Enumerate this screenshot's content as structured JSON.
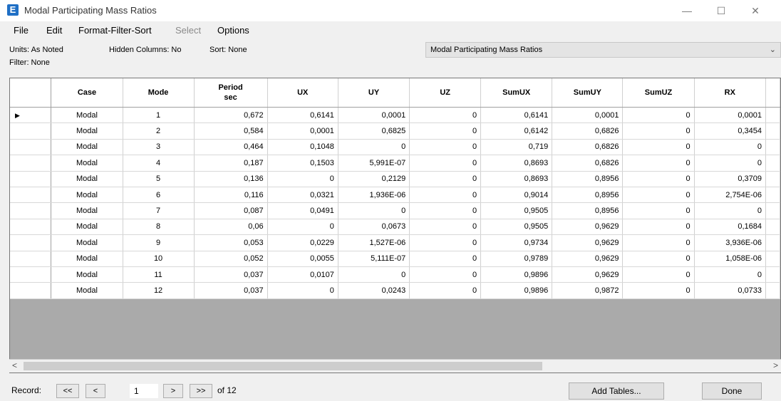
{
  "window": {
    "title": "Modal Participating Mass Ratios",
    "icon_letter": "E"
  },
  "window_controls": {
    "minimize": "—",
    "maximize": "☐",
    "close": "✕"
  },
  "menu": [
    "File",
    "Edit",
    "Format-Filter-Sort",
    "Select",
    "Options"
  ],
  "info": {
    "units": "Units: As Noted",
    "hidden_columns": "Hidden Columns: No",
    "sort": "Sort: None",
    "filter": "Filter: None"
  },
  "table_selector": {
    "value": "Modal Participating Mass Ratios",
    "icon": "chevron-down-icon"
  },
  "columns": [
    {
      "label": "Case",
      "unit": ""
    },
    {
      "label": "Mode",
      "unit": ""
    },
    {
      "label": "Period",
      "unit": "sec"
    },
    {
      "label": "UX",
      "unit": ""
    },
    {
      "label": "UY",
      "unit": ""
    },
    {
      "label": "UZ",
      "unit": ""
    },
    {
      "label": "SumUX",
      "unit": ""
    },
    {
      "label": "SumUY",
      "unit": ""
    },
    {
      "label": "SumUZ",
      "unit": ""
    },
    {
      "label": "RX",
      "unit": ""
    }
  ],
  "rows": [
    [
      "Modal",
      "1",
      "0,672",
      "0,6141",
      "0,0001",
      "0",
      "0,6141",
      "0,0001",
      "0",
      "0,0001"
    ],
    [
      "Modal",
      "2",
      "0,584",
      "0,0001",
      "0,6825",
      "0",
      "0,6142",
      "0,6826",
      "0",
      "0,3454"
    ],
    [
      "Modal",
      "3",
      "0,464",
      "0,1048",
      "0",
      "0",
      "0,719",
      "0,6826",
      "0",
      "0"
    ],
    [
      "Modal",
      "4",
      "0,187",
      "0,1503",
      "5,991E-07",
      "0",
      "0,8693",
      "0,6826",
      "0",
      "0"
    ],
    [
      "Modal",
      "5",
      "0,136",
      "0",
      "0,2129",
      "0",
      "0,8693",
      "0,8956",
      "0",
      "0,3709"
    ],
    [
      "Modal",
      "6",
      "0,116",
      "0,0321",
      "1,936E-06",
      "0",
      "0,9014",
      "0,8956",
      "0",
      "2,754E-06"
    ],
    [
      "Modal",
      "7",
      "0,087",
      "0,0491",
      "0",
      "0",
      "0,9505",
      "0,8956",
      "0",
      "0"
    ],
    [
      "Modal",
      "8",
      "0,06",
      "0",
      "0,0673",
      "0",
      "0,9505",
      "0,9629",
      "0",
      "0,1684"
    ],
    [
      "Modal",
      "9",
      "0,053",
      "0,0229",
      "1,527E-06",
      "0",
      "0,9734",
      "0,9629",
      "0",
      "3,936E-06"
    ],
    [
      "Modal",
      "10",
      "0,052",
      "0,0055",
      "5,111E-07",
      "0",
      "0,9789",
      "0,9629",
      "0",
      "1,058E-06"
    ],
    [
      "Modal",
      "11",
      "0,037",
      "0,0107",
      "0",
      "0",
      "0,9896",
      "0,9629",
      "0",
      "0"
    ],
    [
      "Modal",
      "12",
      "0,037",
      "0",
      "0,0243",
      "0",
      "0,9896",
      "0,9872",
      "0",
      "0,0733"
    ]
  ],
  "current_row_marker": "▶",
  "scrollbar": {
    "left_arrow": "<",
    "right_arrow": ">"
  },
  "footer": {
    "record_label": "Record:",
    "first": "<<",
    "prev": "<",
    "record_value": "1",
    "next": ">",
    "last": ">>",
    "of_label": "of 12",
    "add_tables": "Add Tables...",
    "done": "Done"
  }
}
